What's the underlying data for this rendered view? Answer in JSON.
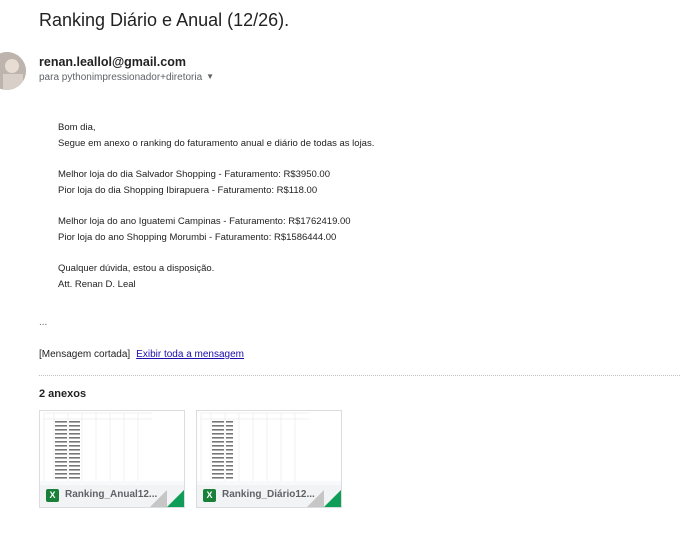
{
  "email": {
    "subject": "Ranking Diário e Anual (12/26).",
    "sender": "renan.leallol@gmail.com",
    "recipient": "para pythonimpressionador+diretoria",
    "body": {
      "greeting": "Bom dia,",
      "intro": "Segue em anexo o ranking do faturamento anual e diário de todas as lojas.",
      "best_day": "Melhor loja do dia Salvador Shopping - Faturamento: R$3950.00",
      "worst_day": "Pior loja do dia Shopping Ibirapuera - Faturamento: R$118.00",
      "best_year": "Melhor loja do ano Iguatemi Campinas - Faturamento: R$1762419.00",
      "worst_year": "Pior loja do ano Shopping Morumbi - Faturamento: R$1586444.00",
      "closing": "Qualquer dúvida, estou a disposição.",
      "signature": "Att. Renan D. Leal"
    },
    "ellipsis": "...",
    "truncated_note": "[Mensagem cortada]",
    "show_full_link": "Exibir toda a mensagem"
  },
  "attachments": {
    "count_label": "2 anexos",
    "items": [
      {
        "name": "Ranking_Anual12...",
        "icon": "excel-icon"
      },
      {
        "name": "Ranking_Diário12...",
        "icon": "excel-icon"
      }
    ]
  },
  "colors": {
    "link": "#1a0dab",
    "excel_green": "#188038"
  }
}
